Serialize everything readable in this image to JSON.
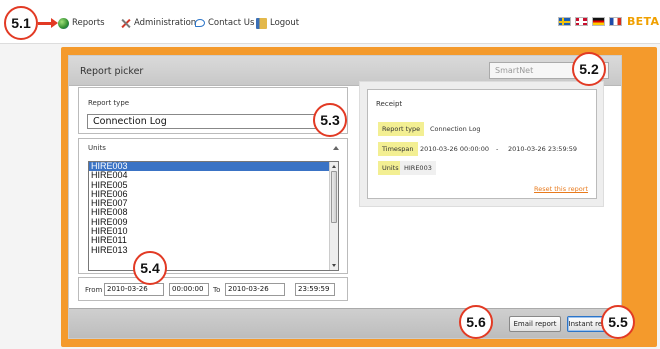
{
  "callouts": {
    "c51": "5.1",
    "c52": "5.2",
    "c53": "5.3",
    "c54": "5.4",
    "c55": "5.5",
    "c56": "5.6"
  },
  "nav": {
    "reports": "Reports",
    "administration": "Administration",
    "contact": "Contact Us",
    "logout": "Logout",
    "beta": "BETA",
    "flags": [
      "sweden-flag",
      "norway-flag",
      "germany-flag",
      "france-flag"
    ]
  },
  "panel": {
    "title": "Report picker",
    "network_select": "SmartNet"
  },
  "report_type": {
    "label": "Report type",
    "value": "Connection Log"
  },
  "units": {
    "label": "Units",
    "items": [
      "HIRE003",
      "HIRE004",
      "HIRE005",
      "HIRE006",
      "HIRE007",
      "HIRE008",
      "HIRE009",
      "HIRE010",
      "HIRE011",
      "HIRE013"
    ],
    "selected": "HIRE003"
  },
  "date_range": {
    "from_label": "From",
    "from_date": "2010-03-26",
    "from_time": "00:00:00",
    "to_label": "To",
    "to_date": "2010-03-26",
    "to_time": "23:59:59"
  },
  "receipt": {
    "title": "Receipt",
    "report_type_label": "Report type",
    "report_type_value": "Connection Log",
    "timespan_label": "Timespan",
    "timespan_start": "2010-03-26 00:00:00",
    "timespan_sep": "-",
    "timespan_end": "2010-03-26 23:59:59",
    "units_label": "Units",
    "units_value": "HIRE003",
    "reset_link": "Reset this report"
  },
  "footer": {
    "email_button": "Email report",
    "instant_button": "Instant report"
  },
  "colors": {
    "frame": "#f49a2c",
    "callout_border": "#e23a24",
    "selected_row": "#3a73c5",
    "receipt_tag": "#f3ef93",
    "link": "#e87a1c",
    "beta": "#f0a000"
  }
}
